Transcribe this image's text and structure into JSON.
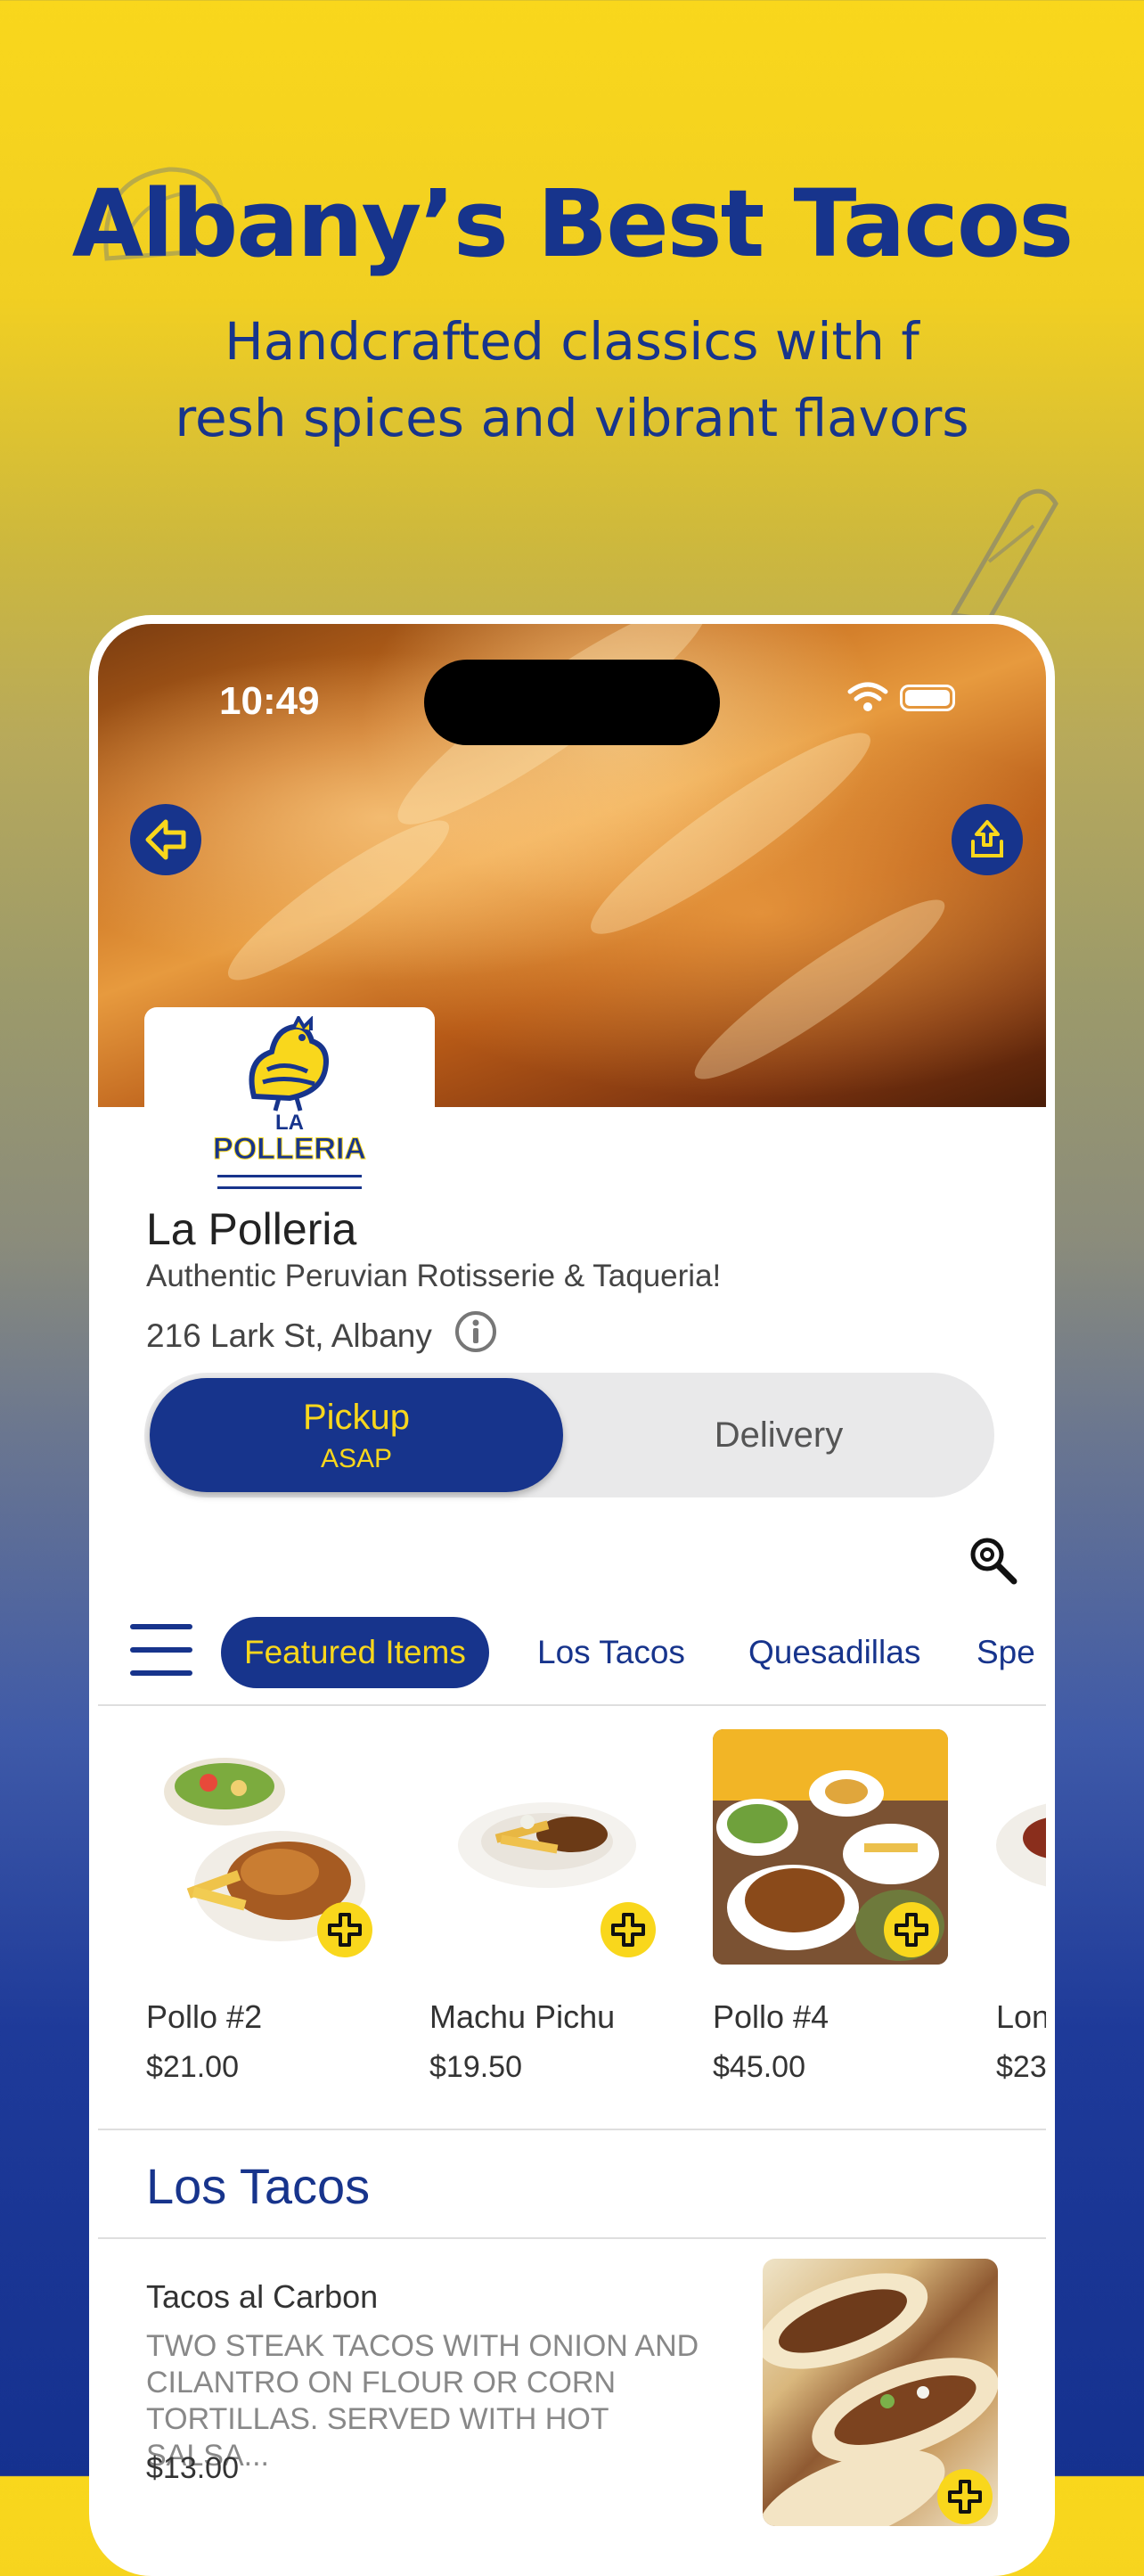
{
  "promo": {
    "headline": "Albany’s Best Tacos",
    "subline": "Handcrafted classics with f\nresh spices and vibrant flavors"
  },
  "status_bar": {
    "time": "10:49"
  },
  "restaurant": {
    "logo_text": "POLLERIA",
    "logo_small": "LA",
    "name": "La Polleria",
    "tagline": "Authentic Peruvian Rotisserie & Taqueria!",
    "address": "216 Lark St, Albany"
  },
  "order_mode": {
    "pickup_label": "Pickup",
    "pickup_time": "ASAP",
    "delivery_label": "Delivery",
    "selected": "Pickup"
  },
  "categories": {
    "active": "Featured Items",
    "tab1": "Los Tacos",
    "tab2": "Quesadillas",
    "tab3": "Spe"
  },
  "featured": [
    {
      "name": "Pollo #2",
      "price": "$21.00"
    },
    {
      "name": "Machu Pichu",
      "price": "$19.50"
    },
    {
      "name": "Pollo #4",
      "price": "$45.00"
    },
    {
      "name": "Lon",
      "price": "$23"
    }
  ],
  "section": {
    "title": "Los Tacos",
    "item": {
      "name": "Tacos al Carbon",
      "description": "TWO STEAK TACOS WITH ONION AND CILANTRO ON FLOUR OR CORN TORTILLAS. SERVED WITH HOT SALSA...",
      "price": "$13.00"
    }
  },
  "colors": {
    "brand_blue": "#17348c",
    "brand_yellow": "#f9d71c"
  },
  "icons": [
    "back-arrow-icon",
    "share-icon",
    "info-icon",
    "search-icon",
    "menu-icon",
    "plus-icon",
    "wifi-icon",
    "battery-icon"
  ]
}
